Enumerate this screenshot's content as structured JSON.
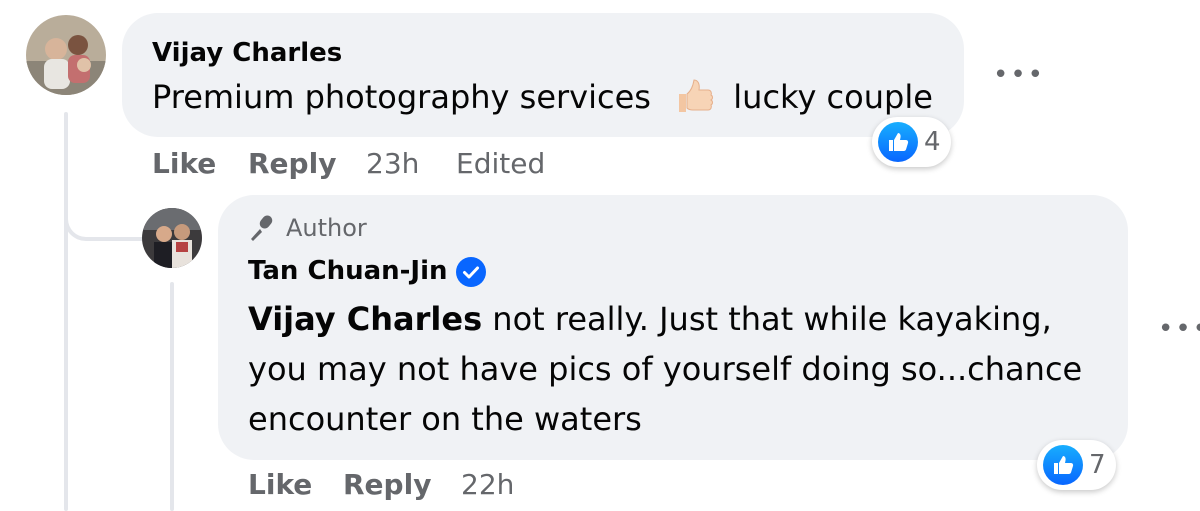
{
  "comment": {
    "author": "Vijay Charles",
    "text_before": "Premium photography services",
    "emoji": "👍🏻",
    "text_after": "lucky couple",
    "actions": {
      "like": "Like",
      "reply": "Reply"
    },
    "time": "23h",
    "edited": "Edited",
    "reaction_count": "4",
    "more_label": "•••"
  },
  "reply": {
    "badge": "Author",
    "author": "Tan Chuan-Jin",
    "mention": "Vijay Charles",
    "line1": " not really. Just that while kayaking,",
    "line2": "you may not have pics of yourself doing so...chance",
    "line3": "encounter on the waters",
    "actions": {
      "like": "Like",
      "reply": "Reply"
    },
    "time": "22h",
    "reaction_count": "7",
    "more_label": "•••"
  },
  "colors": {
    "accent": "#0866ff",
    "bubble": "#f0f2f5",
    "muted": "#65676b"
  },
  "icons": [
    "like-reaction-icon",
    "verified-badge-icon",
    "author-microphone-icon",
    "more-options-icon"
  ]
}
